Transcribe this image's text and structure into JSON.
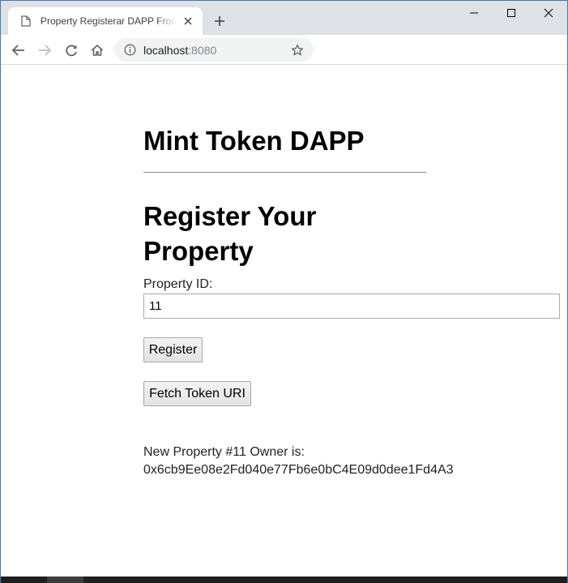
{
  "browser": {
    "tab_title": "Property Registerar DAPP Front End",
    "url_host": "localhost",
    "url_port": ":8080"
  },
  "page": {
    "app_title": "Mint Token DAPP",
    "section_title": "Register Your Property",
    "property_id_label": "Property ID:",
    "property_id_value": "11",
    "register_label": "Register",
    "fetch_label": "Fetch Token URI",
    "result_line1": "New Property #11 Owner is:",
    "result_line2": "0x6cb9Ee08e2Fd040e77Fb6e0bC4E09d0dee1Fd4A3"
  },
  "icons": {
    "tab_favicon": "document-icon",
    "tab_close": "close-icon",
    "new_tab": "plus-icon",
    "back": "arrow-left-icon",
    "forward": "arrow-right-icon",
    "reload": "reload-icon",
    "home": "home-icon",
    "site_info": "info-icon",
    "bookmark": "star-icon"
  },
  "colors": {
    "window_border": "#3c7fb1",
    "tabstrip": "#dee1e6",
    "omnibox": "#f1f3f4"
  }
}
